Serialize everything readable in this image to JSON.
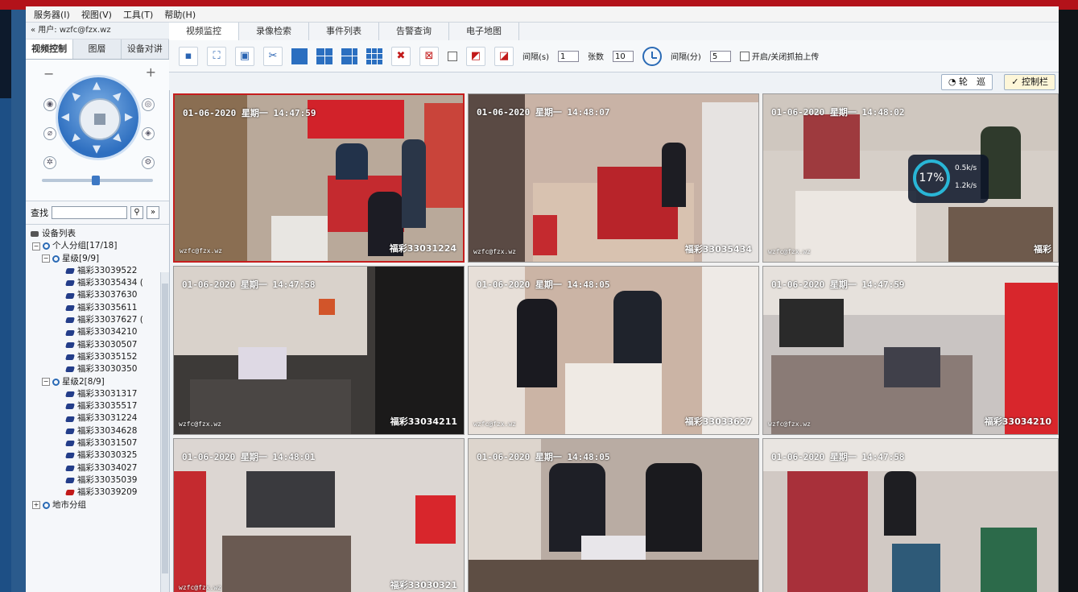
{
  "menu": [
    "服务器(I)",
    "视图(V)",
    "工具(T)",
    "帮助(H)"
  ],
  "user_line": "« 用户: wzfc@fzx.wz",
  "left_tabs": [
    "视频控制",
    "图層",
    "设备对讲"
  ],
  "search": {
    "label": "查找",
    "value": ""
  },
  "tree": {
    "root": "设备列表",
    "group1": "个人分组[17/18]",
    "sub1": "星级[9/9]",
    "sub1_items": [
      "福彩33039522",
      "福彩33035434 (",
      "福彩33037630",
      "福彩33035611",
      "福彩33037627 (",
      "福彩33034210",
      "福彩33030507",
      "福彩33035152",
      "福彩33030350"
    ],
    "sub2": "星级2[8/9]",
    "sub2_items": [
      "福彩33031317",
      "福彩33035517",
      "福彩33031224",
      "福彩33034628",
      "福彩33031507",
      "福彩33030325",
      "福彩33034027",
      "福彩33035039",
      "福彩33039209"
    ],
    "group2": "地市分组"
  },
  "main_tabs": [
    "视频监控",
    "录像检索",
    "事件列表",
    "告警查询",
    "电子地图"
  ],
  "toolbar": {
    "interval_label": "间隔(s)",
    "interval_value": "1",
    "sheets_label": "张数",
    "sheets_value": "10",
    "interval_min_label": "间隔(分)",
    "interval_min_value": "5",
    "upload_label": "开启/关闭抓拍上传"
  },
  "subbar": {
    "patrol": "轮　巡",
    "control": "控制栏"
  },
  "colors": {
    "accent": "#2b6fc0",
    "selected_border": "#c61e1e"
  },
  "speed_widget": {
    "percent": "17%",
    "up": "0.5k/s",
    "down": "1.2k/s"
  },
  "cameras": [
    {
      "time": "01-06-2020 星期一 14:47:59",
      "wm": "wzfc@fzx.wz",
      "id": "福彩33031224"
    },
    {
      "time": "01-06-2020 星期一 14:48:07",
      "wm": "wzfc@fzx.wz",
      "id": "福彩33035434"
    },
    {
      "time": "01-06-2020 星期一 14:48:02",
      "wm": "wzfc@fzx.wz",
      "id": "福彩"
    },
    {
      "time": "01-06-2020 星期一 14:47:58",
      "wm": "wzfc@fzx.wz",
      "id": "福彩33034211"
    },
    {
      "time": "01-06-2020 星期一 14:48:05",
      "wm": "wzfc@fzx.wz",
      "id": "福彩33033627"
    },
    {
      "time": "01-06-2020 星期一 14:47:59",
      "wm": "wzfc@fzx.wz",
      "id": "福彩33034210"
    },
    {
      "time": "01-06-2020 星期一 14:48:01",
      "wm": "wzfc@fzx.wz",
      "id": "福彩33030321"
    },
    {
      "time": "01-06-2020 星期一 14:48:05",
      "wm": "",
      "id": ""
    },
    {
      "time": "01-06-2020 星期一 14:47:58",
      "wm": "",
      "id": ""
    }
  ]
}
